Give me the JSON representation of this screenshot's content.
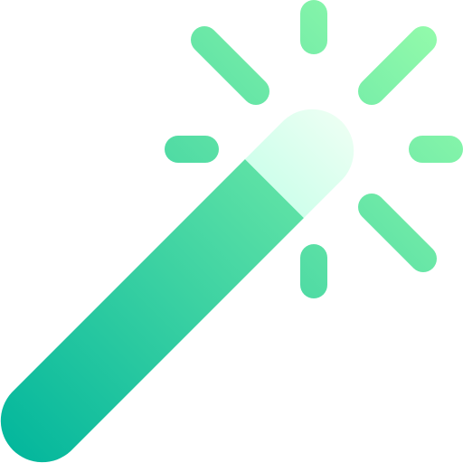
{
  "icon": {
    "name": "magic-wand-icon",
    "colors": {
      "gradient_start": "#00b59c",
      "gradient_end": "#9cffac",
      "tip_start": "#c3ffe8",
      "tip_end": "#f0fff4"
    }
  }
}
